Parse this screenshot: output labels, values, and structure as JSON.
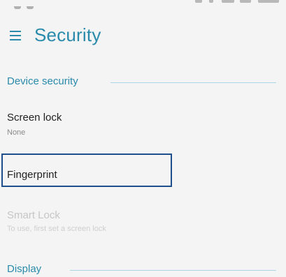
{
  "header": {
    "title": "Security",
    "menu_icon": "hamburger-menu-icon"
  },
  "sections": {
    "device_security": {
      "label": "Device security"
    },
    "display": {
      "label": "Display"
    }
  },
  "items": {
    "screen_lock": {
      "title": "Screen lock",
      "subtitle": "None"
    },
    "fingerprint": {
      "title": "Fingerprint"
    },
    "smart_lock": {
      "title": "Smart Lock",
      "subtitle": "To use, first set a screen lock"
    }
  },
  "colors": {
    "accent": "#2a8aab",
    "highlight_border": "#1f4f8a",
    "background": "#f4f4f4"
  }
}
